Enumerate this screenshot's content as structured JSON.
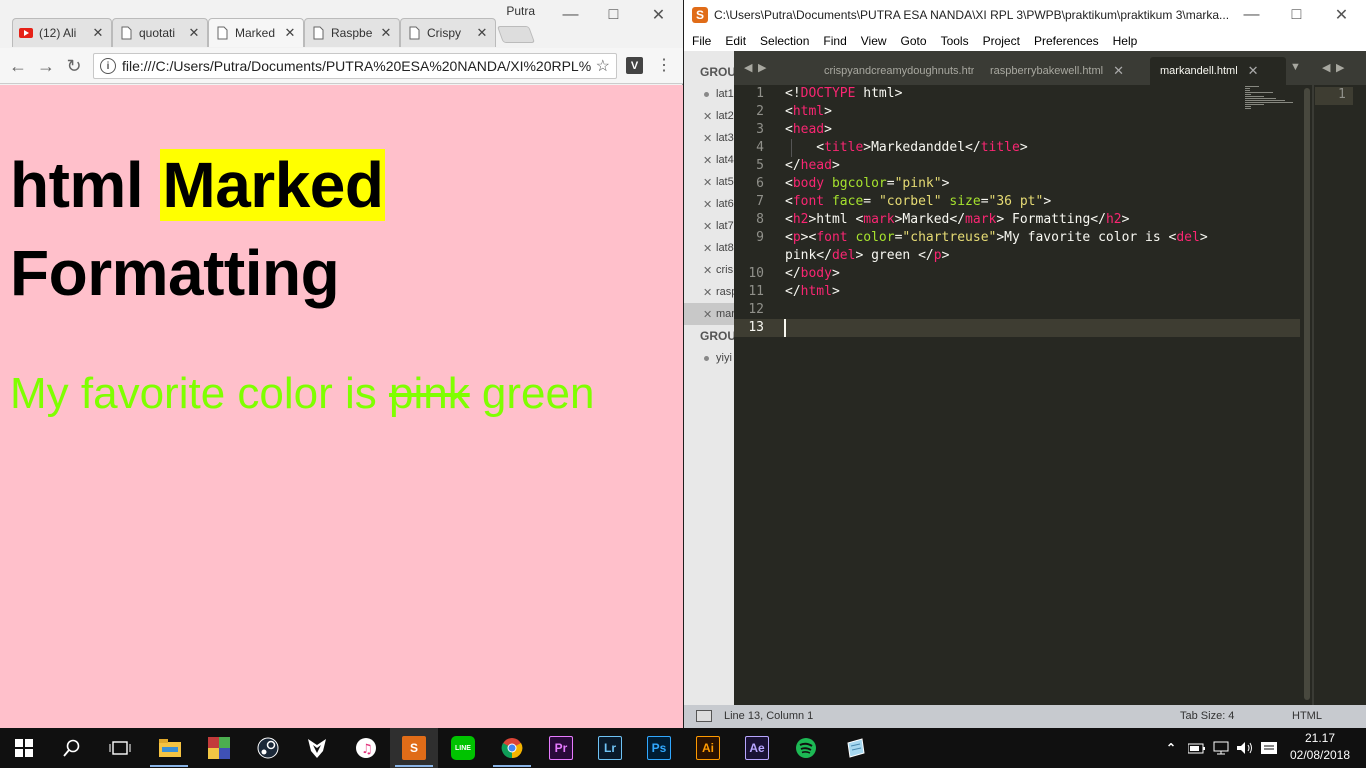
{
  "chrome": {
    "profile_name": "Putra",
    "tabs": [
      {
        "label": "(12) Ali",
        "icon": "youtube-icon"
      },
      {
        "label": "quotati",
        "icon": "page-icon"
      },
      {
        "label": "Marked",
        "icon": "page-icon",
        "active": true
      },
      {
        "label": "Raspbe",
        "icon": "page-icon"
      },
      {
        "label": "Crispy",
        "icon": "page-icon"
      }
    ],
    "url": "file:///C:/Users/Putra/Documents/PUTRA%20ESA%20NANDA/XI%20RPL%...",
    "extension_label": "V",
    "page": {
      "heading_pre": "html ",
      "heading_mark": "Marked",
      "heading_post": " Formatting",
      "para_pre": "My favorite color is ",
      "para_del": "pink",
      "para_post": " green",
      "bg_color": "#ffc0cb",
      "text_color": "#7fff00",
      "mark_color": "#ffff00"
    }
  },
  "sublime": {
    "title": "C:\\Users\\Putra\\Documents\\PUTRA ESA NANDA\\XI RPL 3\\PWPB\\praktikum\\praktikum 3\\marka...",
    "menu": [
      "File",
      "Edit",
      "Selection",
      "Find",
      "View",
      "Goto",
      "Tools",
      "Project",
      "Preferences",
      "Help"
    ],
    "sidebar": {
      "group1": "GROU",
      "group2": "GROU",
      "items": [
        "lat1",
        "lat2",
        "lat3",
        "lat4",
        "lat5",
        "lat6",
        "lat7",
        "lat8",
        "cris",
        "rasp",
        "mar"
      ],
      "group2_items": [
        "yiyi"
      ]
    },
    "tabs": [
      {
        "label": "crispyandcreamydoughnuts.htr"
      },
      {
        "label": "raspberrybakewell.html"
      },
      {
        "label": "markandell.html",
        "active": true
      }
    ],
    "line_numbers": [
      "1",
      "2",
      "3",
      "4",
      "5",
      "6",
      "7",
      "8",
      "9",
      "",
      "10",
      "11",
      "12",
      "13"
    ],
    "code_lines": [
      [
        [
          "p",
          "<!"
        ],
        [
          "t",
          "DOCTYPE"
        ],
        [
          "p",
          " html>"
        ]
      ],
      [
        [
          "p",
          "<"
        ],
        [
          "t",
          "html"
        ],
        [
          "p",
          ">"
        ]
      ],
      [
        [
          "p",
          "<"
        ],
        [
          "t",
          "head"
        ],
        [
          "p",
          ">"
        ]
      ],
      [
        [
          "p",
          "    <"
        ],
        [
          "t",
          "title"
        ],
        [
          "p",
          ">Markedanddel</"
        ],
        [
          "t",
          "title"
        ],
        [
          "p",
          ">"
        ]
      ],
      [
        [
          "p",
          "</"
        ],
        [
          "t",
          "head"
        ],
        [
          "p",
          ">"
        ]
      ],
      [
        [
          "p",
          "<"
        ],
        [
          "t",
          "body"
        ],
        [
          "p",
          " "
        ],
        [
          "a",
          "bgcolor"
        ],
        [
          "p",
          "="
        ],
        [
          "s",
          "\"pink\""
        ],
        [
          "p",
          ">"
        ]
      ],
      [
        [
          "p",
          "<"
        ],
        [
          "t",
          "font"
        ],
        [
          "p",
          " "
        ],
        [
          "a",
          "face"
        ],
        [
          "p",
          "= "
        ],
        [
          "s",
          "\"corbel\""
        ],
        [
          "p",
          " "
        ],
        [
          "a",
          "size"
        ],
        [
          "p",
          "="
        ],
        [
          "s",
          "\"36 pt\""
        ],
        [
          "p",
          ">"
        ]
      ],
      [
        [
          "p",
          "<"
        ],
        [
          "t",
          "h2"
        ],
        [
          "p",
          ">html <"
        ],
        [
          "t",
          "mark"
        ],
        [
          "p",
          ">Marked</"
        ],
        [
          "t",
          "mark"
        ],
        [
          "p",
          "> Formatting</"
        ],
        [
          "t",
          "h2"
        ],
        [
          "p",
          ">"
        ]
      ],
      [
        [
          "p",
          "<"
        ],
        [
          "t",
          "p"
        ],
        [
          "p",
          "><"
        ],
        [
          "t",
          "font"
        ],
        [
          "p",
          " "
        ],
        [
          "a",
          "color"
        ],
        [
          "p",
          "="
        ],
        [
          "s",
          "\"chartreuse\""
        ],
        [
          "p",
          ">My favorite color is <"
        ],
        [
          "t",
          "del"
        ],
        [
          "p",
          ">"
        ]
      ],
      [
        [
          "p",
          "pink</"
        ],
        [
          "t",
          "del"
        ],
        [
          "p",
          "> green </"
        ],
        [
          "t",
          "p"
        ],
        [
          "p",
          ">"
        ]
      ],
      [
        [
          "p",
          "</"
        ],
        [
          "t",
          "body"
        ],
        [
          "p",
          ">"
        ]
      ],
      [
        [
          "p",
          "</"
        ],
        [
          "t",
          "html"
        ],
        [
          "p",
          ">"
        ]
      ],
      [],
      []
    ],
    "pane2_line": "1",
    "status": {
      "position": "Line 13, Column 1",
      "tab_size": "Tab Size: 4",
      "syntax": "HTML"
    }
  },
  "taskbar": {
    "time": "21.17",
    "date": "02/08/2018",
    "apps": [
      "start-icon",
      "search-icon",
      "task-view-icon",
      "file-explorer-icon",
      "winrar-icon",
      "steam-icon",
      "fl-studio-icon",
      "itunes-icon",
      "sublime-text-icon",
      "line-icon",
      "chrome-icon",
      "premiere-icon",
      "lightroom-icon",
      "photoshop-icon",
      "illustrator-icon",
      "after-effects-icon",
      "spotify-icon",
      "notepad-icon"
    ],
    "app_labels": {
      "premiere": "Pr",
      "lightroom": "Lr",
      "photoshop": "Ps",
      "illustrator": "Ai",
      "after_effects": "Ae",
      "line": "LINE"
    }
  }
}
